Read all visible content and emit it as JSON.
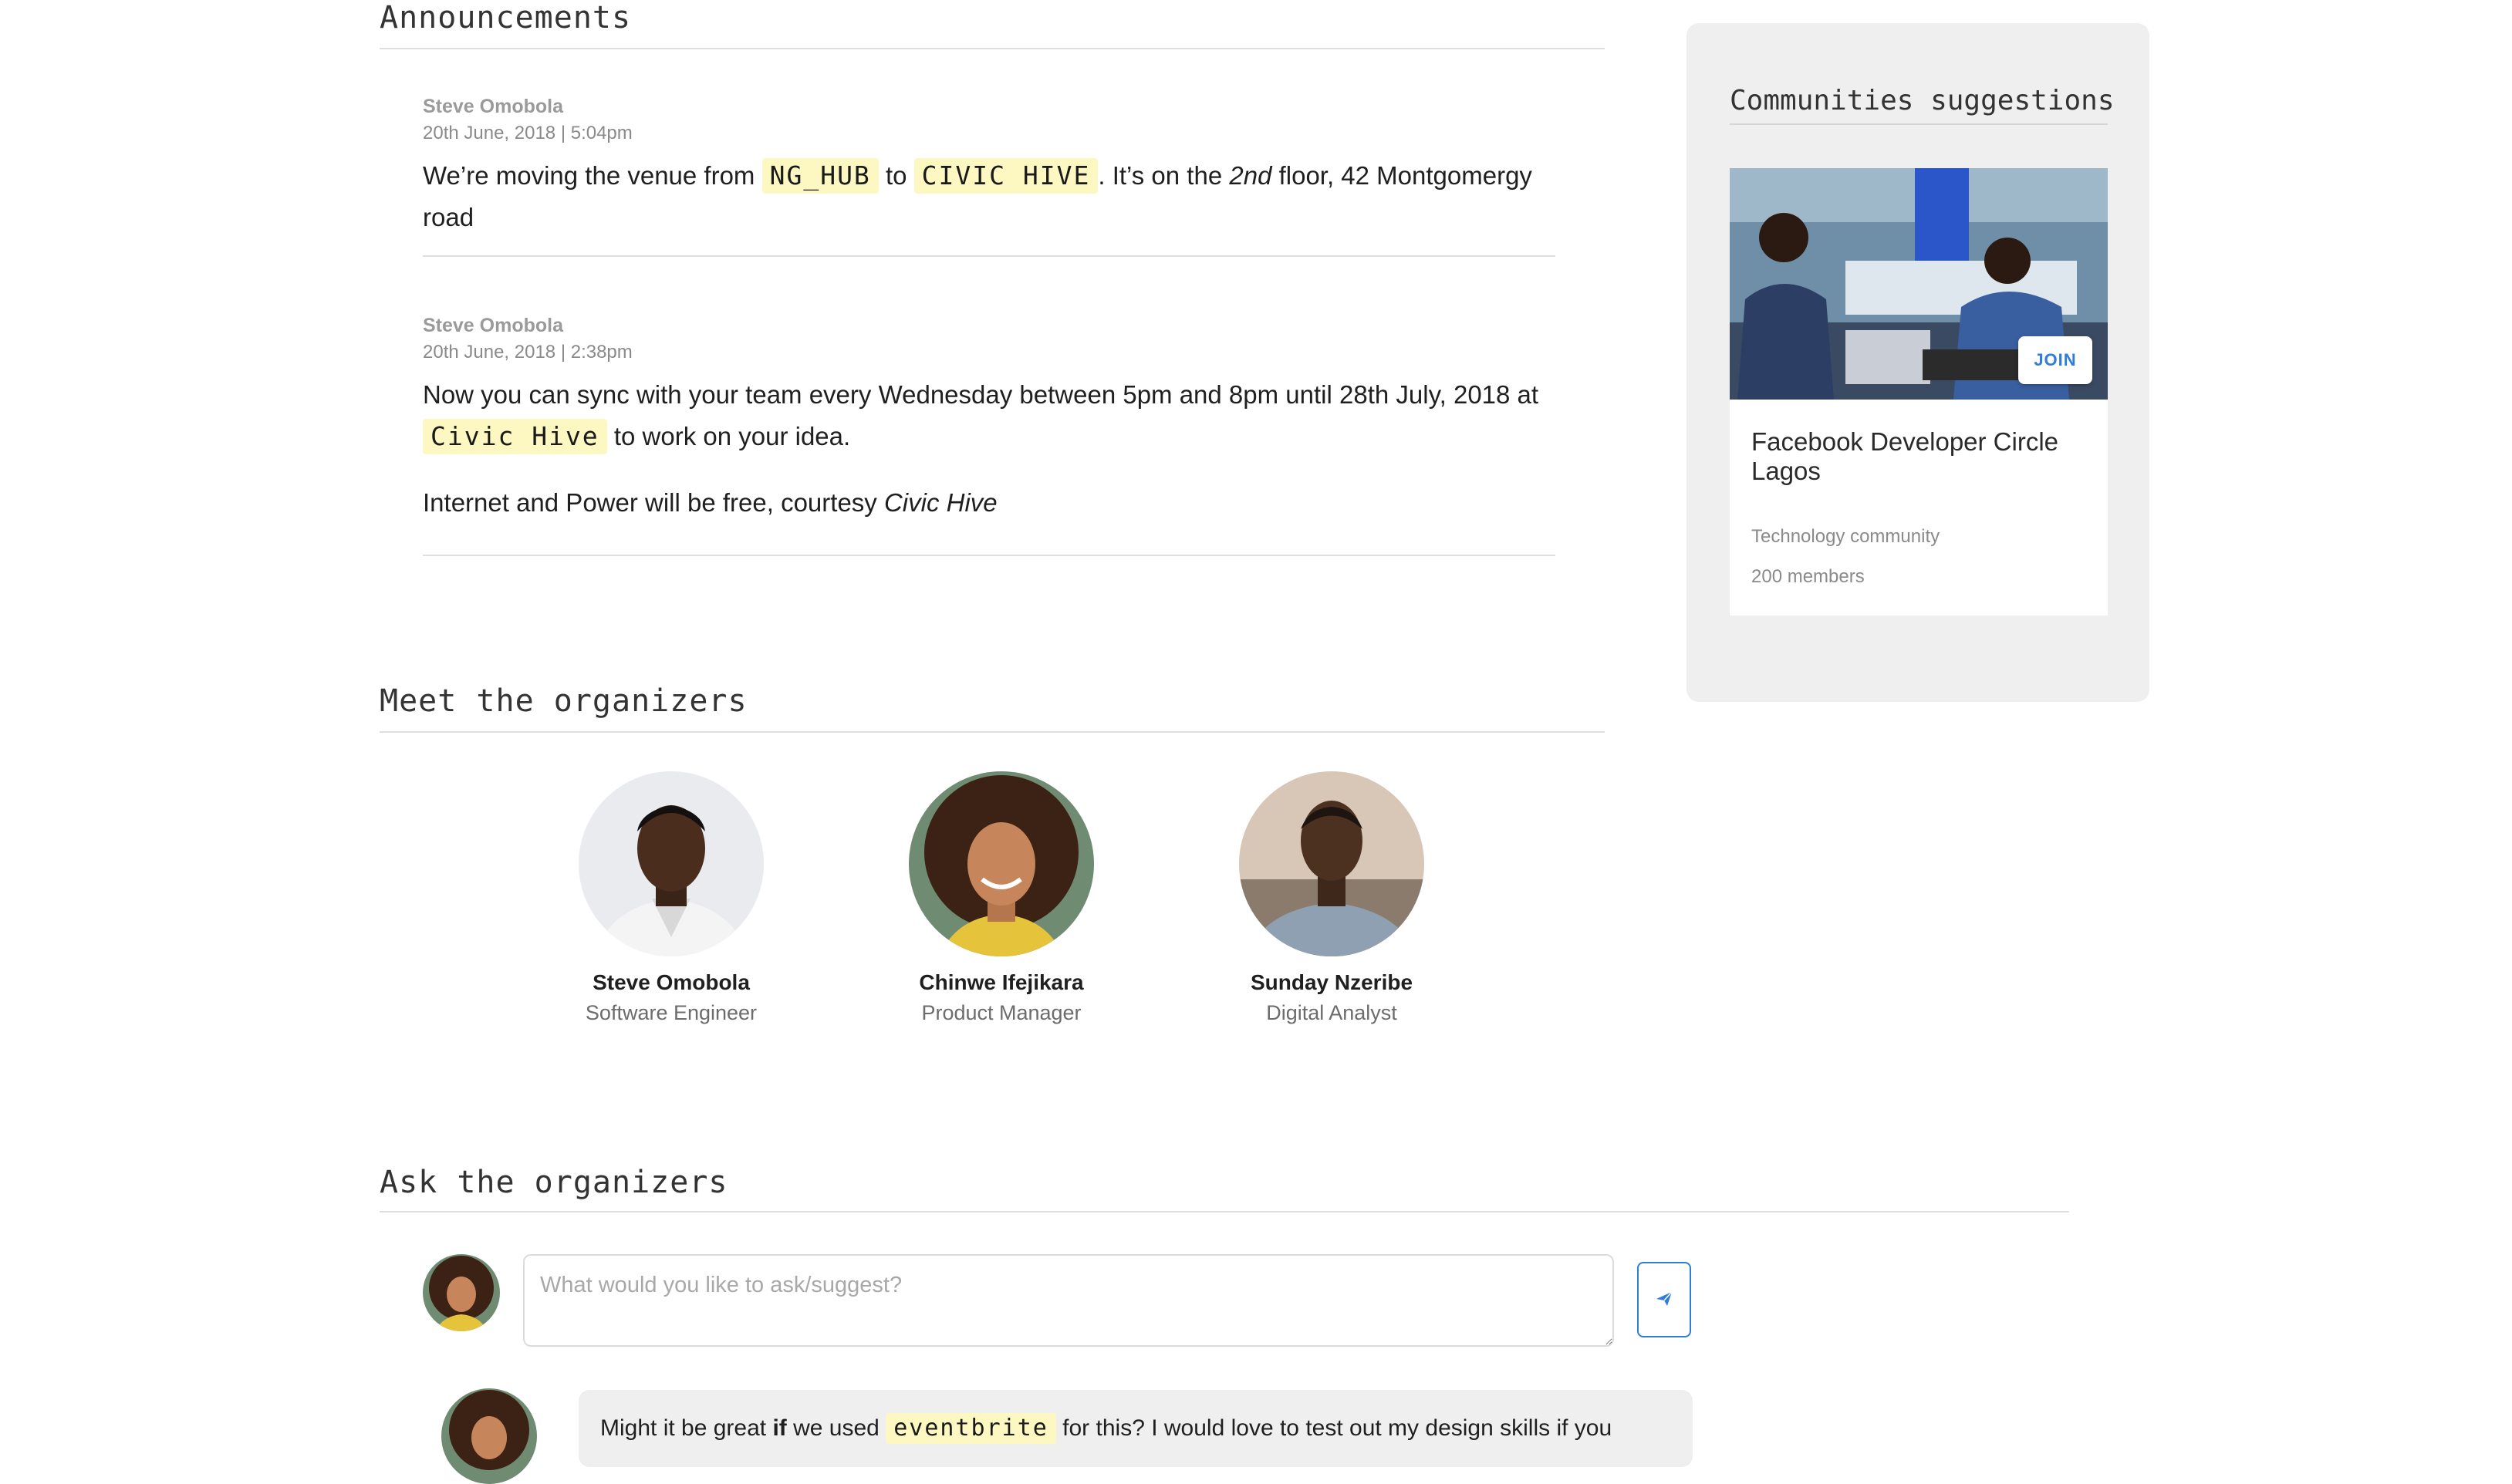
{
  "announcements": {
    "title": "Announcements",
    "posts": [
      {
        "author": "Steve Omobola",
        "date": "20th June, 2018 | 5:04pm",
        "p1": {
          "t1": "We’re moving the venue from ",
          "code1": "NG_HUB",
          "t2": " to ",
          "code2": "CIVIC HIVE",
          "t3": ". It’s on the ",
          "em": "2nd",
          "t4": " floor, 42 Montgomergy road"
        }
      },
      {
        "author": "Steve Omobola",
        "date": "20th June, 2018 | 2:38pm",
        "p1": {
          "t1": "Now you can sync with your team every Wednesday between 5pm and 8pm until 28th July, 2018 at ",
          "code1": "Civic Hive",
          "t2": " to work on your idea."
        },
        "p2": {
          "t1": "Internet and Power will be free, courtesy ",
          "em": "Civic Hive"
        }
      }
    ]
  },
  "organizers": {
    "title": "Meet the organizers",
    "people": [
      {
        "name": "Steve Omobola",
        "role": "Software Engineer"
      },
      {
        "name": "Chinwe Ifejikara",
        "role": "Product Manager"
      },
      {
        "name": "Sunday Nzeribe",
        "role": "Digital Analyst"
      }
    ]
  },
  "ask": {
    "title": "Ask the organizers",
    "placeholder": "What would you like to ask/suggest?",
    "send_icon": "paper-plane-icon",
    "comment": {
      "t1": "Might it be great ",
      "bold": "if",
      "t2": " we used ",
      "code": "eventbrite",
      "t3": " for this?  I would love to test out my design skills if you"
    }
  },
  "sidebar": {
    "title": "Communities suggestions",
    "card": {
      "name": "Facebook Developer Circle Lagos",
      "type": "Technology community",
      "members": "200 members",
      "join_label": "JOIN"
    }
  },
  "colors": {
    "accent": "#2f7dd8",
    "highlight": "#fdf8c2",
    "sidebar_bg": "#efefef"
  }
}
